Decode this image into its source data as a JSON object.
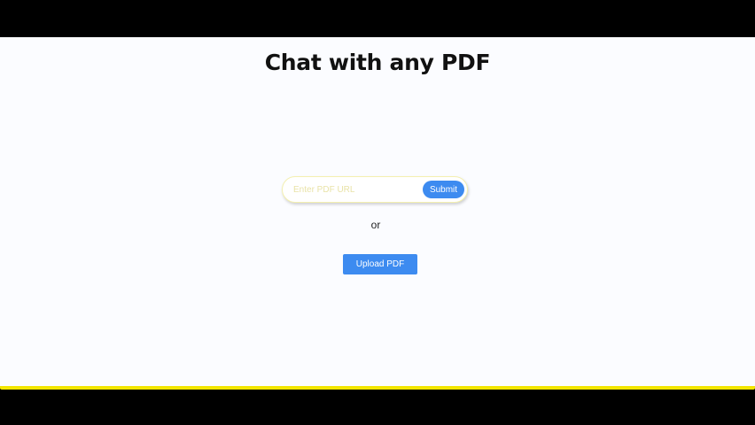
{
  "header": {
    "title": "Chat with any PDF"
  },
  "url_form": {
    "placeholder": "Enter PDF URL",
    "value": "",
    "submit_label": "Submit"
  },
  "divider": {
    "text": "or"
  },
  "upload": {
    "label": "Upload PDF"
  },
  "colors": {
    "page_background": "#fbfcff",
    "primary_button": "#3d8bf0",
    "accent_bar": "#f3e600",
    "input_border": "#f4f0b0"
  }
}
